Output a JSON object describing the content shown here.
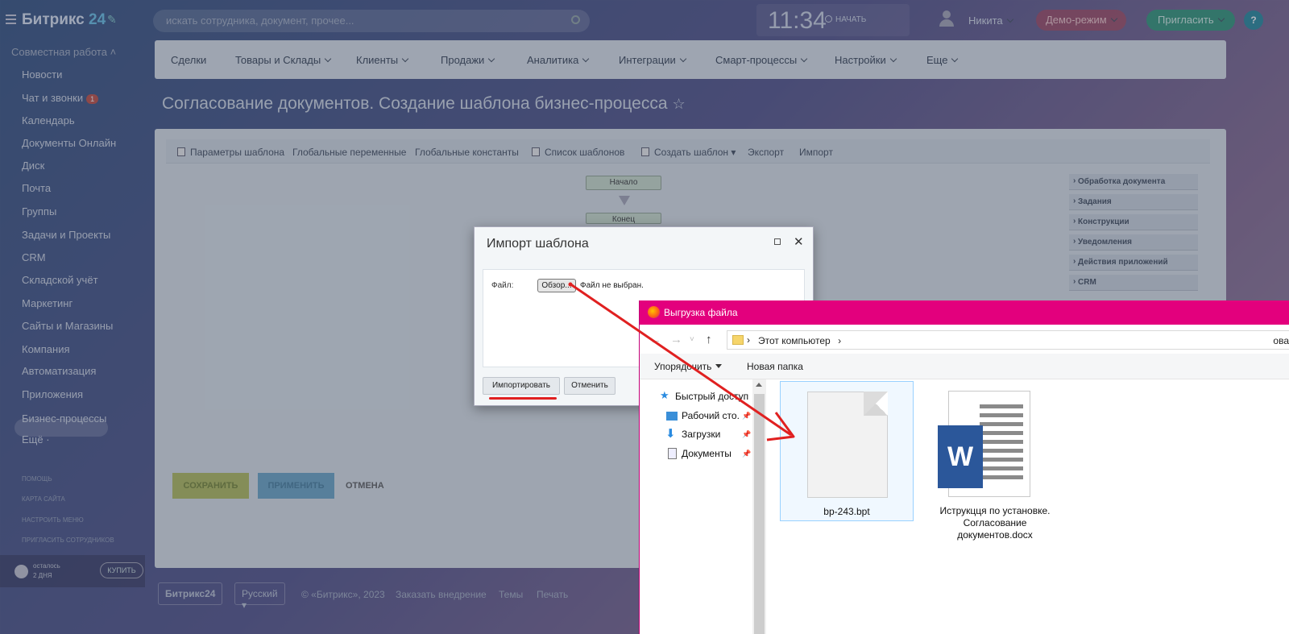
{
  "topbar": {
    "logo_main": "Битрикс",
    "logo_24": " 24",
    "search_placeholder": "искать сотрудника, документ, прочее...",
    "clock": "11:34",
    "start_label": "НАЧАТЬ",
    "user_name": "Никита",
    "demo_label": "Демо-режим",
    "invite_label": "Пригласить",
    "help_label": "?"
  },
  "sidebar": {
    "section_label": "Совместная работа",
    "items": [
      {
        "label": "Новости"
      },
      {
        "label": "Чат и звонки",
        "badge": "1"
      },
      {
        "label": "Календарь"
      },
      {
        "label": "Документы Онлайн"
      },
      {
        "label": "Диск"
      },
      {
        "label": "Почта"
      },
      {
        "label": "Группы"
      },
      {
        "label": "Задачи и Проекты"
      },
      {
        "label": "CRM"
      },
      {
        "label": "Складской учёт"
      },
      {
        "label": "Маркетинг"
      },
      {
        "label": "Сайты и Магазины"
      },
      {
        "label": "Компания"
      },
      {
        "label": "Автоматизация"
      },
      {
        "label": "Приложения"
      },
      {
        "label": "Бизнес-процессы"
      },
      {
        "label": "Ещё ·"
      }
    ],
    "footer_links": [
      "ПОМОЩЬ",
      "КАРТА САЙТА",
      "НАСТРОИТЬ МЕНЮ",
      "ПРИГЛАСИТЬ СОТРУДНИКОВ"
    ],
    "trial_line1": "осталось",
    "trial_line2": "2 ДНЯ",
    "buy_label": "КУПИТЬ"
  },
  "menubar": {
    "items": [
      "Сделки",
      "Товары и Склады",
      "Клиенты",
      "Продажи",
      "Аналитика",
      "Интеграции",
      "Смарт-процессы",
      "Настройки",
      "Еще"
    ]
  },
  "page_title": "Согласование документов. Создание шаблона бизнес-процесса",
  "toolbar": {
    "items": [
      "Параметры шаблона",
      "Глобальные переменные",
      "Глобальные константы",
      "Список шаблонов",
      "Создать шаблон",
      "Экспорт",
      "Импорт"
    ]
  },
  "diagram": {
    "start_node": "Начало",
    "end_node": "Конец"
  },
  "side_tools": [
    "Обработка документа",
    "Задания",
    "Конструкции",
    "Уведомления",
    "Действия приложений",
    "CRM"
  ],
  "panel_buttons": {
    "save": "СОХРАНИТЬ",
    "apply": "ПРИМЕНИТЬ",
    "cancel": "ОТМЕНА"
  },
  "footer": {
    "brand": "Битрикс24",
    "language": "Русский",
    "copyright": "© «Битрикс», 2023",
    "order": "Заказать внедрение",
    "themes": "Темы",
    "print": "Печать"
  },
  "import_dialog": {
    "title": "Импорт шаблона",
    "file_label": "Файл:",
    "browse_label": "Обзор...",
    "no_file": "Файл не выбран.",
    "import_button": "Импортировать",
    "cancel_button": "Отменить"
  },
  "file_dialog": {
    "title": "Выгрузка файла",
    "address": "Этот компьютер",
    "address_right": "ова",
    "organize": "Упорядочить",
    "new_folder": "Новая папка",
    "tree": [
      "Быстрый доступ",
      "Рабочий сто.",
      "Загрузки",
      "Документы"
    ],
    "files": [
      {
        "name": "bp-243.bpt",
        "icon": "blank-file-icon"
      },
      {
        "name_lines": [
          "Иструкцця по установке.",
          "Согласование",
          "документов.docx"
        ],
        "icon": "word-document-icon"
      }
    ]
  },
  "annotation": {
    "arrow_color": "#e02020"
  }
}
